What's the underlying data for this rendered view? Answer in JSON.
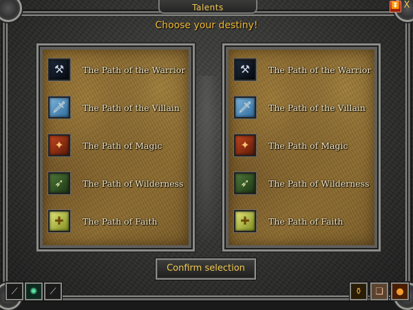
{
  "window": {
    "title": "Talents",
    "minimize_symbol": "⏬",
    "close_label": "X"
  },
  "subtitle": "Choose your destiny!",
  "panels": {
    "left": {
      "talents": [
        {
          "label": "The Path of the Warrior",
          "icon": "battle-axe-icon",
          "glyph": "⚒"
        },
        {
          "label": "The Path of the Villain",
          "icon": "dagger-icon",
          "glyph": "🗡"
        },
        {
          "label": "The Path of Magic",
          "icon": "spellbook-icon",
          "glyph": "✦"
        },
        {
          "label": "The Path of Wilderness",
          "icon": "bow-icon",
          "glyph": "➶"
        },
        {
          "label": "The Path of Faith",
          "icon": "holy-scroll-icon",
          "glyph": "✚"
        }
      ]
    },
    "right": {
      "talents": [
        {
          "label": "The Path of the Warrior",
          "icon": "battle-axe-icon",
          "glyph": "⚒"
        },
        {
          "label": "The Path of the Villain",
          "icon": "dagger-icon",
          "glyph": "🗡"
        },
        {
          "label": "The Path of Magic",
          "icon": "spellbook-icon",
          "glyph": "✦"
        },
        {
          "label": "The Path of Wilderness",
          "icon": "bow-icon",
          "glyph": "➶"
        },
        {
          "label": "The Path of Faith",
          "icon": "holy-scroll-icon",
          "glyph": "✚"
        }
      ]
    }
  },
  "confirm_button": "Confirm selection",
  "bottom_bar": {
    "left_icons": [
      {
        "name": "sword-icon",
        "glyph": "⟋"
      },
      {
        "name": "rune-icon",
        "glyph": "✺"
      },
      {
        "name": "sword-icon",
        "glyph": "⟋"
      }
    ],
    "right_icons": [
      {
        "name": "flask-icon",
        "glyph": "⚱"
      },
      {
        "name": "scroll-icon",
        "glyph": "❑"
      },
      {
        "name": "orb-icon",
        "glyph": "●"
      }
    ]
  },
  "colors": {
    "title_gold": "#f0c850",
    "subtitle_gold": "#f0b830",
    "parchment": "#8d6b2e",
    "frame_stone": "#6d6d6b",
    "label_text": "#f1e6c4"
  }
}
